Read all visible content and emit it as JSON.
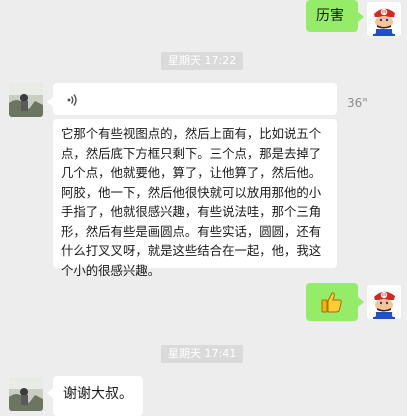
{
  "messages": {
    "m1": {
      "text": "历害"
    },
    "time1": {
      "label": "星期天 17:22"
    },
    "voice": {
      "duration": "36\"",
      "transcript": "它那个有些视图点的，然后上面有，比如说五个点，然后底下方框只剩下。三个点，那是去掉了几个点，他就要他，算了，让他算了，然后他。阿胶，他一下，然后他很快就可以放用那他的小手指了，他就很感兴趣，有些说法哇，那个三角形，然后有些是画圆点。有些实话，圆圆，还有什么打叉叉呀，就是这些结合在一起，他，我这个小的很感兴趣。"
    },
    "m3": {
      "icon": "thumbs-up-icon"
    },
    "time2": {
      "label": "星期天 17:41"
    },
    "m4": {
      "text": "谢谢大叔。"
    }
  },
  "colors": {
    "background": "#ededed",
    "outgoing_bubble": "#95ec69",
    "incoming_bubble": "#ffffff",
    "time_chip": "#dadada"
  }
}
